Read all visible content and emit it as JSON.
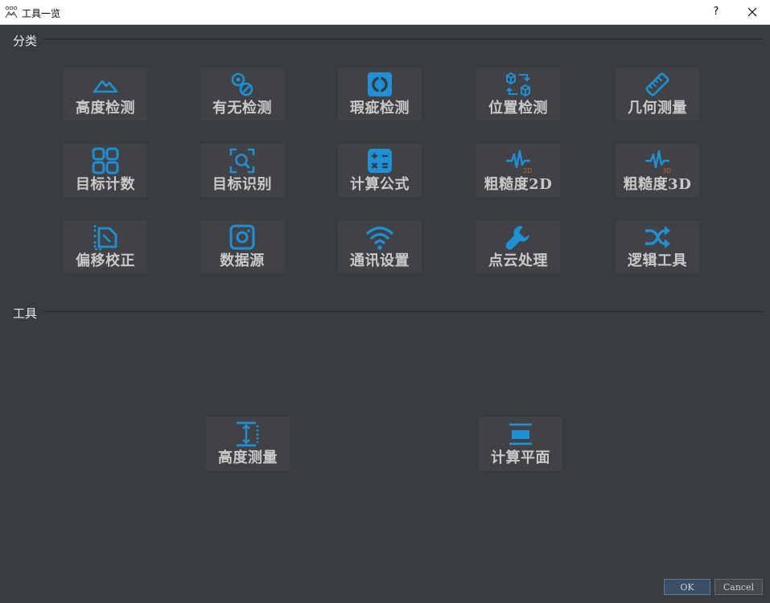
{
  "window": {
    "title": "工具一览",
    "help_label": "?"
  },
  "sections": [
    {
      "label": "分类"
    },
    {
      "label": "工具"
    }
  ],
  "categories": [
    {
      "label": "高度检测",
      "icon": "mountain-icon"
    },
    {
      "label": "有无检测",
      "icon": "presence-icon"
    },
    {
      "label": "瑕疵检测",
      "icon": "defect-icon"
    },
    {
      "label": "位置检测",
      "icon": "position-icon"
    },
    {
      "label": "几何测量",
      "icon": "ruler-icon"
    },
    {
      "label": "目标计数",
      "icon": "grid-icon"
    },
    {
      "label": "目标识别",
      "icon": "scan-search-icon"
    },
    {
      "label": "计算公式",
      "icon": "calculator-icon"
    },
    {
      "label": "粗糙度2D",
      "icon": "wave-2d-icon",
      "badge": "2D"
    },
    {
      "label": "粗糙度3D",
      "icon": "wave-3d-icon",
      "badge": "3D"
    },
    {
      "label": "偏移校正",
      "icon": "offset-icon"
    },
    {
      "label": "数据源",
      "icon": "camera-icon"
    },
    {
      "label": "通讯设置",
      "icon": "wifi-icon"
    },
    {
      "label": "点云处理",
      "icon": "wrench-icon"
    },
    {
      "label": "逻辑工具",
      "icon": "shuffle-icon"
    }
  ],
  "tools": [
    {
      "label": "高度测量",
      "icon": "height-measure-icon"
    },
    {
      "label": "计算平面",
      "icon": "plane-icon"
    }
  ],
  "buttons": {
    "ok": "OK",
    "cancel": "Cancel"
  },
  "colors": {
    "accent": "#1f8fd6",
    "badge": "#b5651d",
    "background": "#383b40",
    "tile": "#404246"
  }
}
